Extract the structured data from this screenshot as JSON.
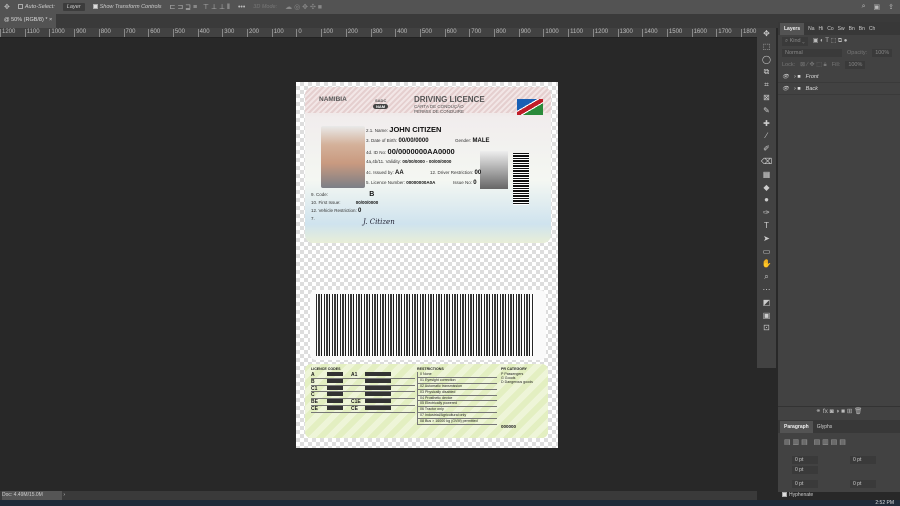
{
  "options_bar": {
    "auto_select": "Auto-Select:",
    "auto_select_value": "Layer",
    "show_transform": "Show Transform Controls",
    "mode_3d": "3D Mode:"
  },
  "document_tab": {
    "title": "@ 50% (RGB/8) *",
    "close": "×"
  },
  "ruler": {
    "labels": [
      "1200",
      "1100",
      "1000",
      "900",
      "800",
      "700",
      "600",
      "500",
      "400",
      "300",
      "200",
      "100",
      "0",
      "100",
      "200",
      "300",
      "400",
      "500",
      "600",
      "700",
      "800",
      "900",
      "1000",
      "1100",
      "1200",
      "1300",
      "1400",
      "1500",
      "1600",
      "1700",
      "1800"
    ]
  },
  "layers_panel": {
    "tabs": [
      "Layers",
      "Na",
      "Hi",
      "Co",
      "Sw",
      "Bn",
      "Bn",
      "Ch"
    ],
    "filter": "Kind",
    "blend_mode": "Normal",
    "opacity_label": "Opacity:",
    "opacity": "100%",
    "lock_label": "Lock:",
    "fill_label": "Fill:",
    "fill": "100%",
    "layers": [
      {
        "name": "Front"
      },
      {
        "name": "Back"
      }
    ]
  },
  "paragraph_panel": {
    "tabs": [
      "Paragraph",
      "Glyphs"
    ],
    "fields": [
      "0 pt",
      "0 pt",
      "0 pt",
      "0 pt",
      "0 pt"
    ],
    "hyphenate": "Hyphenate"
  },
  "card_front": {
    "country": "NAMIBIA",
    "sadc": "SADC",
    "nam": "NAM",
    "title": "DRIVING LICENCE",
    "subtitle1": "CARTA DE CONDUÇÃO",
    "subtitle2": "PERMIS DE CONDUIRE",
    "name_label": "2.1. Name:",
    "name": "JOHN CITIZEN",
    "dob_label": "3. Date of Birth:",
    "dob": "00/00/0000",
    "gender_label": "Gender:",
    "gender": "MALE",
    "id_label": "4d. ID No:",
    "id": "00/0000000AA0000",
    "validity_label": "4a,4b/11. Validity:",
    "validity": "00/00/0000 - 00/00/0000",
    "issued_label": "4c. Issued by:",
    "issued": "AA",
    "restriction_label": "12. Driver Restriction:",
    "restriction": "00",
    "licence_label": "5. Licence Number:",
    "licence": "00000000A0A",
    "issue_no_label": "Issue No:",
    "issue_no": "0",
    "code_label": "9. Code:",
    "code": "B",
    "first_issue_label": "10. First Issue:",
    "first_issue": "00/00/0000",
    "vehicle_label": "12. Vehicle Restriction:",
    "vehicle": "0",
    "sig_label": "7.",
    "signature": "J. Citizen"
  },
  "card_back": {
    "codes_title": "LICENCE CODES",
    "codes": [
      "A",
      "B",
      "C1",
      "C",
      "BE",
      "CE"
    ],
    "codes2": [
      "A1",
      "",
      "",
      "",
      "C1E",
      "CE"
    ],
    "restrictions_title": "RESTRICTIONS",
    "restrictions": [
      "0 None",
      "01 Eyesight correction",
      "02 Automatic transmission",
      "03 Physically disabled",
      "04 Prosthetic device",
      "05 Electrically powered",
      "06 Tractor only",
      "07 Industrial/Agricultural only",
      "08 Bus > 16000 kg (GVM) permitted"
    ],
    "pr_title": "PR CATEGORY",
    "pr": [
      "P Passengers",
      "G Goods",
      "D Dangerous goods"
    ],
    "serial": "000000"
  },
  "status_bar": {
    "doc": "Doc: 4.49M/15.0M"
  },
  "clock": "2:52 PM"
}
